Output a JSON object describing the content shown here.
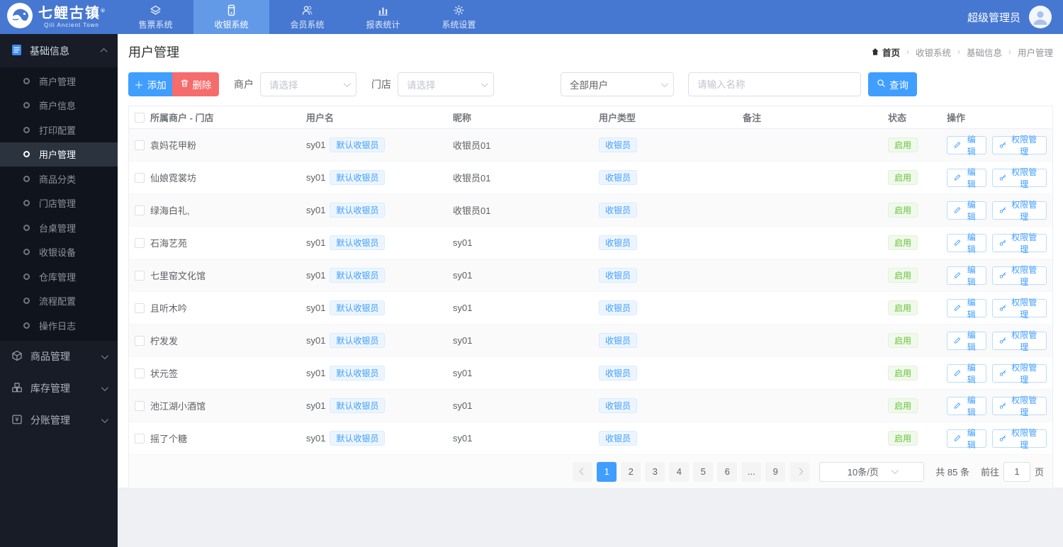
{
  "colors": {
    "accent": "#409eff",
    "danger": "#f56c6c",
    "success": "#67c23a",
    "navbar": "#4678d2",
    "navbar_active": "#639ae8",
    "sidebar": "#171c26",
    "tag_blue_bg": "#ecf5ff",
    "tag_green_bg": "#f0f9eb"
  },
  "navbar": {
    "logo_title": "七鲤古镇",
    "logo_reg": "®",
    "logo_subtitle": "Qili Ancient Town",
    "items": [
      {
        "label": "售票系统",
        "icon": "ticket-icon",
        "active": false
      },
      {
        "label": "收银系统",
        "icon": "pos-icon",
        "active": true
      },
      {
        "label": "会员系统",
        "icon": "members-icon",
        "active": false
      },
      {
        "label": "报表统计",
        "icon": "report-icon",
        "active": false
      },
      {
        "label": "系统设置",
        "icon": "gear-icon",
        "active": false
      }
    ],
    "user_name": "超级管理员"
  },
  "sidebar": {
    "group_label": "基础信息",
    "submenu": [
      {
        "label": "商户管理",
        "active": false
      },
      {
        "label": "商户信息",
        "active": false
      },
      {
        "label": "打印配置",
        "active": false
      },
      {
        "label": "用户管理",
        "active": true
      },
      {
        "label": "商品分类",
        "active": false
      },
      {
        "label": "门店管理",
        "active": false
      },
      {
        "label": "台桌管理",
        "active": false
      },
      {
        "label": "收银设备",
        "active": false
      },
      {
        "label": "仓库管理",
        "active": false
      },
      {
        "label": "流程配置",
        "active": false
      },
      {
        "label": "操作日志",
        "active": false
      }
    ],
    "collapsed_groups": [
      {
        "label": "商品管理"
      },
      {
        "label": "库存管理"
      },
      {
        "label": "分账管理"
      }
    ]
  },
  "page": {
    "title": "用户管理",
    "breadcrumb_home": "首页",
    "breadcrumb": [
      "收银系统",
      "基础信息",
      "用户管理"
    ]
  },
  "toolbar": {
    "add_label": "添加",
    "delete_label": "删除",
    "merchant_label": "商户",
    "merchant_placeholder": "请选择",
    "store_label": "门店",
    "store_placeholder": "请选择",
    "user_type_value": "全部用户",
    "search_placeholder": "请输入名称",
    "search_label": "查询"
  },
  "table": {
    "columns": [
      "所属商户 - 门店",
      "用户名",
      "昵称",
      "用户类型",
      "备注",
      "状态",
      "操作"
    ],
    "edit_label": "编辑",
    "perm_label": "权限管理",
    "rows": [
      {
        "merchant": "袁妈花甲粉",
        "username": "sy01",
        "user_tag": "默认收银员",
        "nickname": "收银员01",
        "type": "收银员",
        "remark": "",
        "status": "启用"
      },
      {
        "merchant": "仙娘霓裳坊",
        "username": "sy01",
        "user_tag": "默认收银员",
        "nickname": "收银员01",
        "type": "收银员",
        "remark": "",
        "status": "启用"
      },
      {
        "merchant": "绿海白礼,",
        "username": "sy01",
        "user_tag": "默认收银员",
        "nickname": "收银员01",
        "type": "收银员",
        "remark": "",
        "status": "启用"
      },
      {
        "merchant": "石海艺苑",
        "username": "sy01",
        "user_tag": "默认收银员",
        "nickname": "sy01",
        "type": "收银员",
        "remark": "",
        "status": "启用"
      },
      {
        "merchant": "七里窑文化馆",
        "username": "sy01",
        "user_tag": "默认收银员",
        "nickname": "sy01",
        "type": "收银员",
        "remark": "",
        "status": "启用"
      },
      {
        "merchant": "且听木吟",
        "username": "sy01",
        "user_tag": "默认收银员",
        "nickname": "sy01",
        "type": "收银员",
        "remark": "",
        "status": "启用"
      },
      {
        "merchant": "柠发发",
        "username": "sy01",
        "user_tag": "默认收银员",
        "nickname": "sy01",
        "type": "收银员",
        "remark": "",
        "status": "启用"
      },
      {
        "merchant": "状元签",
        "username": "sy01",
        "user_tag": "默认收银员",
        "nickname": "sy01",
        "type": "收银员",
        "remark": "",
        "status": "启用"
      },
      {
        "merchant": "池江湖小酒馆",
        "username": "sy01",
        "user_tag": "默认收银员",
        "nickname": "sy01",
        "type": "收银员",
        "remark": "",
        "status": "启用"
      },
      {
        "merchant": "摇了个糖",
        "username": "sy01",
        "user_tag": "默认收银员",
        "nickname": "sy01",
        "type": "收银员",
        "remark": "",
        "status": "启用"
      }
    ]
  },
  "pagination": {
    "pages": [
      {
        "label": "1",
        "active": true
      },
      {
        "label": "2",
        "active": false
      },
      {
        "label": "3",
        "active": false
      },
      {
        "label": "4",
        "active": false
      },
      {
        "label": "5",
        "active": false
      },
      {
        "label": "6",
        "active": false
      },
      {
        "label": "...",
        "active": false
      },
      {
        "label": "9",
        "active": false
      }
    ],
    "page_size": "10条/页",
    "total": "共 85 条",
    "goto_prefix": "前往",
    "goto_value": "1",
    "goto_suffix": "页"
  }
}
